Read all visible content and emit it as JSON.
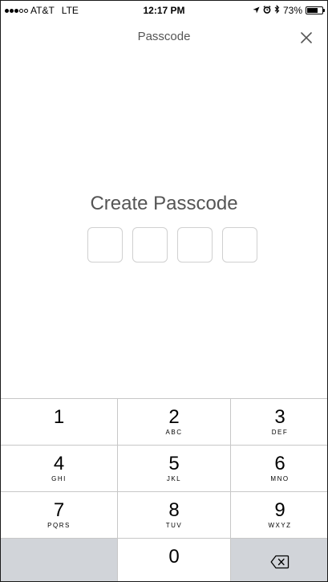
{
  "status_bar": {
    "carrier": "AT&T",
    "network": "LTE",
    "time": "12:17 PM",
    "battery": "73%",
    "battery_level": 0.73,
    "signal_bars_filled": 3,
    "signal_bars_total": 5
  },
  "nav": {
    "title": "Passcode",
    "close_icon": "close-icon"
  },
  "main": {
    "heading": "Create Passcode",
    "passcode_length": 4
  },
  "keypad": {
    "keys": [
      {
        "num": "1",
        "letters": ""
      },
      {
        "num": "2",
        "letters": "ABC"
      },
      {
        "num": "3",
        "letters": "DEF"
      },
      {
        "num": "4",
        "letters": "GHI"
      },
      {
        "num": "5",
        "letters": "JKL"
      },
      {
        "num": "6",
        "letters": "MNO"
      },
      {
        "num": "7",
        "letters": "PQRS"
      },
      {
        "num": "8",
        "letters": "TUV"
      },
      {
        "num": "9",
        "letters": "WXYZ"
      },
      {
        "num": "0",
        "letters": ""
      }
    ],
    "delete_icon": "backspace-icon"
  }
}
